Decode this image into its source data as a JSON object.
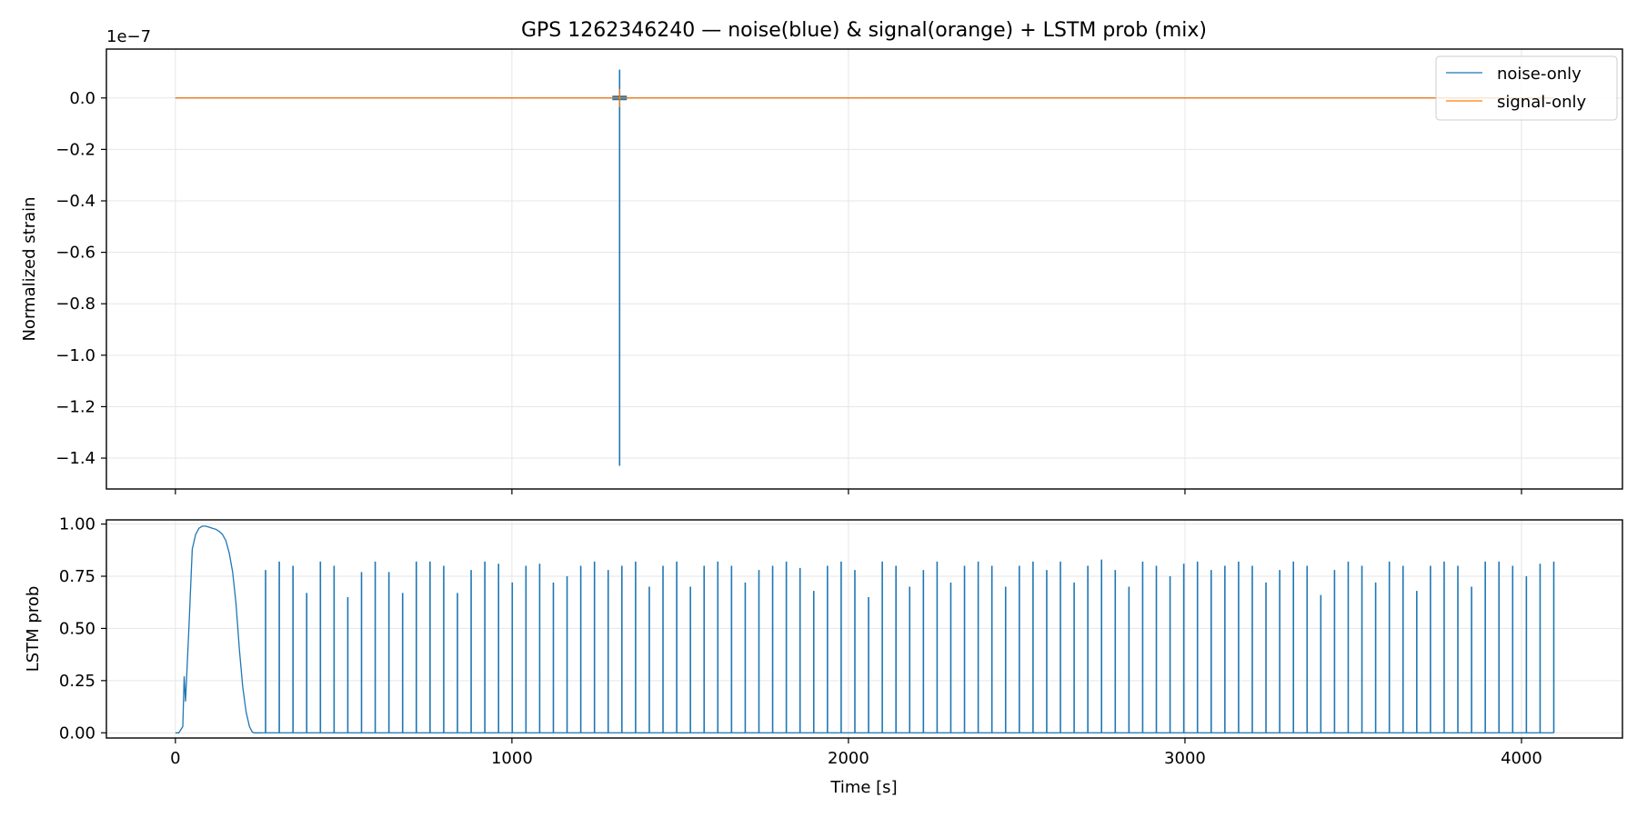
{
  "chart_data": [
    {
      "type": "line",
      "title": "GPS 1262346240 — noise(blue) & signal(orange) + LSTM prob (mix)",
      "xlabel": "",
      "ylabel": "Normalized strain",
      "offset_label": "1e−7",
      "ylim": [
        -1.52,
        0.19
      ],
      "xlim": [
        -205,
        4300
      ],
      "grid": true,
      "legend_position": "top-right",
      "x_ticks": [
        0,
        1000,
        2000,
        3000,
        4000
      ],
      "y_ticks": [
        {
          "value": 0.0,
          "label": "0.0"
        },
        {
          "value": -0.2,
          "label": "−0.2"
        },
        {
          "value": -0.4,
          "label": "−0.4"
        },
        {
          "value": -0.6,
          "label": "−0.6"
        },
        {
          "value": -0.8,
          "label": "−0.8"
        },
        {
          "value": -1.0,
          "label": "−1.0"
        },
        {
          "value": -1.2,
          "label": "−1.2"
        },
        {
          "value": -1.4,
          "label": "−1.4"
        }
      ],
      "series": [
        {
          "name": "noise-only",
          "color": "#1f77b4",
          "baseline": 0.0,
          "x_range": [
            0,
            4096
          ],
          "spike": {
            "x": 1320,
            "max": 0.11,
            "min": -1.43
          }
        },
        {
          "name": "signal-only",
          "color": "#ff7f0e",
          "baseline": 0.0,
          "x_range": [
            0,
            4096
          ]
        }
      ]
    },
    {
      "type": "line",
      "title": "",
      "xlabel": "Time [s]",
      "ylabel": "LSTM prob",
      "ylim": [
        -0.025,
        1.02
      ],
      "xlim": [
        -205,
        4300
      ],
      "grid": true,
      "x_ticks": [
        {
          "value": 0,
          "label": "0"
        },
        {
          "value": 1000,
          "label": "1000"
        },
        {
          "value": 2000,
          "label": "2000"
        },
        {
          "value": 3000,
          "label": "3000"
        },
        {
          "value": 4000,
          "label": "4000"
        }
      ],
      "y_ticks": [
        {
          "value": 0.0,
          "label": "0.00"
        },
        {
          "value": 0.25,
          "label": "0.25"
        },
        {
          "value": 0.5,
          "label": "0.50"
        },
        {
          "value": 0.75,
          "label": "0.75"
        },
        {
          "value": 1.0,
          "label": "1.00"
        }
      ],
      "series": [
        {
          "name": "",
          "color": "#1f77b4",
          "hump": {
            "x": [
              0,
              10,
              22,
              26,
              30,
              40,
              50,
              60,
              70,
              80,
              90,
              100,
              110,
              120,
              130,
              140,
              150,
              160,
              170,
              180,
              190,
              200,
              210,
              220,
              228,
              234,
              240,
              255
            ],
            "y": [
              0.0,
              0.0,
              0.03,
              0.27,
              0.15,
              0.5,
              0.88,
              0.95,
              0.98,
              0.99,
              0.99,
              0.985,
              0.98,
              0.975,
              0.965,
              0.95,
              0.92,
              0.86,
              0.77,
              0.62,
              0.4,
              0.22,
              0.1,
              0.03,
              0.005,
              0.0,
              0.0,
              0.0
            ]
          },
          "spikes": {
            "x_start": 268,
            "x_end": 4096,
            "peak_min": 0.65,
            "peak_max": 0.83,
            "peaks": [
              0.78,
              0.82,
              0.8,
              0.67,
              0.82,
              0.8,
              0.65,
              0.77,
              0.82,
              0.77,
              0.67,
              0.82,
              0.82,
              0.8,
              0.67,
              0.78,
              0.82,
              0.81,
              0.72,
              0.8,
              0.81,
              0.72,
              0.75,
              0.8,
              0.82,
              0.78,
              0.8,
              0.82,
              0.7,
              0.8,
              0.82,
              0.7,
              0.8,
              0.82,
              0.8,
              0.72,
              0.78,
              0.8,
              0.82,
              0.79,
              0.68,
              0.8,
              0.82,
              0.78,
              0.65,
              0.82,
              0.8,
              0.7,
              0.78,
              0.82,
              0.72,
              0.8,
              0.82,
              0.8,
              0.7,
              0.8,
              0.82,
              0.78,
              0.82,
              0.72,
              0.8,
              0.83,
              0.78,
              0.7,
              0.82,
              0.8,
              0.75,
              0.81,
              0.82,
              0.78,
              0.8,
              0.82,
              0.8,
              0.72,
              0.78,
              0.82,
              0.8,
              0.66,
              0.78,
              0.82,
              0.8,
              0.72,
              0.82,
              0.8,
              0.68,
              0.8,
              0.82,
              0.8,
              0.7,
              0.82,
              0.82,
              0.8,
              0.75,
              0.81,
              0.82
            ]
          }
        }
      ]
    }
  ]
}
